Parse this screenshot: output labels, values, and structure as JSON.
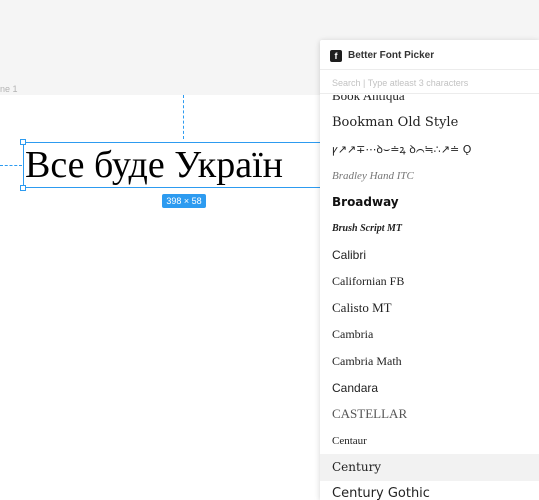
{
  "canvas": {
    "frame_name": "ne 1",
    "text_content": "Все буде Україн",
    "size_badge": "398 × 58"
  },
  "plugin": {
    "logo_letter": "f",
    "title": "Better Font Picker",
    "search_placeholder": "Search | Type atleast 3 characters",
    "fonts": [
      {
        "label": "Book Antiqua",
        "family": "Liberation Serif",
        "size": "13px",
        "style": "normal",
        "weight": "normal",
        "variant": "normal",
        "color": "#222"
      },
      {
        "label": "Bookman Old Style",
        "family": "DejaVu Serif",
        "size": "13px",
        "style": "normal",
        "weight": "normal",
        "variant": "normal",
        "color": "#222"
      },
      {
        "label": "ꝩ↗↗∓⋯ꝺ⌣≐ꝝ ꝺ⌒≒∴↗≐ Ǫ",
        "family": "DejaVu Sans",
        "size": "11px",
        "style": "normal",
        "weight": "normal",
        "variant": "normal",
        "color": "#222"
      },
      {
        "label": "Bradley Hand ITC",
        "family": "Liberation Serif",
        "size": "11px",
        "style": "italic",
        "weight": "normal",
        "variant": "normal",
        "color": "#777"
      },
      {
        "label": "Broadway",
        "family": "DejaVu Sans",
        "size": "12px",
        "style": "normal",
        "weight": "bold",
        "variant": "normal",
        "color": "#111"
      },
      {
        "label": "Brush Script MT",
        "family": "Liberation Serif",
        "size": "10px",
        "style": "italic",
        "weight": "bold",
        "variant": "normal",
        "color": "#222"
      },
      {
        "label": "Calibri",
        "family": "Liberation Sans",
        "size": "12px",
        "style": "normal",
        "weight": "normal",
        "variant": "normal",
        "color": "#222"
      },
      {
        "label": "Californian FB",
        "family": "Liberation Serif",
        "size": "12px",
        "style": "normal",
        "weight": "normal",
        "variant": "normal",
        "color": "#222"
      },
      {
        "label": "Calisto MT",
        "family": "Liberation Serif",
        "size": "13px",
        "style": "normal",
        "weight": "normal",
        "variant": "normal",
        "color": "#222"
      },
      {
        "label": "Cambria",
        "family": "Liberation Serif",
        "size": "12px",
        "style": "normal",
        "weight": "normal",
        "variant": "normal",
        "color": "#222"
      },
      {
        "label": "Cambria Math",
        "family": "Liberation Serif",
        "size": "12px",
        "style": "normal",
        "weight": "normal",
        "variant": "normal",
        "color": "#222"
      },
      {
        "label": "Candara",
        "family": "Liberation Sans",
        "size": "12px",
        "style": "normal",
        "weight": "normal",
        "variant": "normal",
        "color": "#222"
      },
      {
        "label": "CASTELLAR",
        "family": "Liberation Serif",
        "size": "13px",
        "style": "normal",
        "weight": "normal",
        "variant": "normal",
        "color": "#555"
      },
      {
        "label": "Centaur",
        "family": "Liberation Serif",
        "size": "11px",
        "style": "normal",
        "weight": "normal",
        "variant": "normal",
        "color": "#222"
      },
      {
        "label": "Century",
        "family": "DejaVu Serif",
        "size": "12px",
        "style": "normal",
        "weight": "normal",
        "variant": "normal",
        "color": "#222",
        "hover": true
      },
      {
        "label": "Century Gothic",
        "family": "DejaVu Sans",
        "size": "13px",
        "style": "normal",
        "weight": "normal",
        "variant": "normal",
        "color": "#222"
      }
    ]
  },
  "colors": {
    "selection": "#2d9bf0",
    "hover_row": "#f2f2f2"
  }
}
